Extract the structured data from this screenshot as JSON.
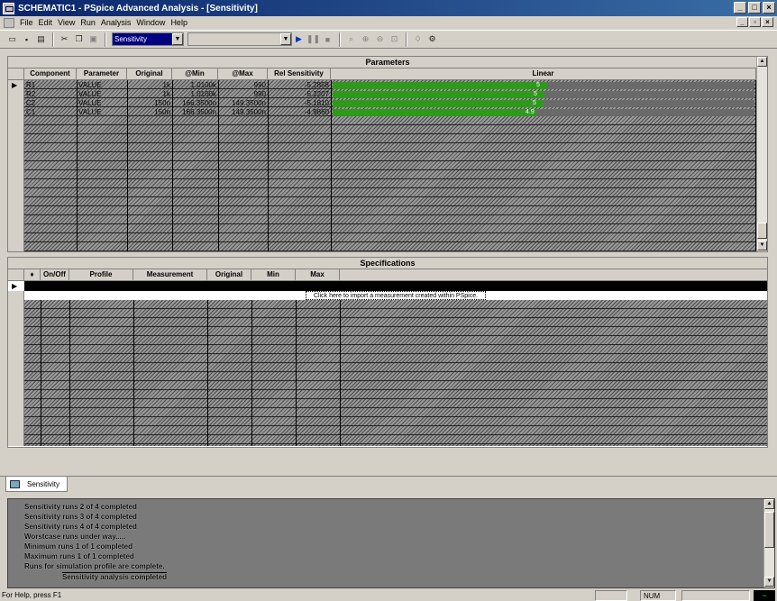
{
  "window": {
    "title": "SCHEMATIC1 - PSpice Advanced Analysis - [Sensitivity]",
    "min_label": "_",
    "max_label": "□",
    "close_label": "×",
    "mdi_min_label": "_",
    "mdi_restore_label": "▫",
    "mdi_close_label": "×"
  },
  "menu": [
    "File",
    "Edit",
    "View",
    "Run",
    "Analysis",
    "Window",
    "Help"
  ],
  "toolbar": {
    "analysis_combo": "Sensitivity",
    "profile_combo": "",
    "combo_arrow": "▼",
    "icons": [
      "open-icon",
      "save-icon",
      "print-icon",
      "cut-icon",
      "copy-icon",
      "paste-icon",
      "run-icon",
      "pause-icon",
      "stop-icon",
      "zoom-fit-icon",
      "zoom-in-icon",
      "zoom-out-icon",
      "zoom-area-icon",
      "find-icon",
      "settings-icon"
    ]
  },
  "parameters": {
    "section_title": "Parameters",
    "columns": [
      "Component",
      "Parameter",
      "Original",
      "@Min",
      "@Max",
      "Rel Sensitivity",
      "Linear"
    ],
    "rows": [
      {
        "component": "R1",
        "parameter": "VALUE",
        "original": "1k",
        "min": "1.0100k",
        "max": "990",
        "rel": "-5.2858",
        "bar_label": "5",
        "fraction": 0.99
      },
      {
        "component": "R2",
        "parameter": "VALUE",
        "original": "1k",
        "min": "1.0100k",
        "max": "990",
        "rel": "-5.2207",
        "bar_label": "5",
        "fraction": 0.98
      },
      {
        "component": "C2",
        "parameter": "VALUE",
        "original": "150n",
        "min": "166.3500n",
        "max": "149.3500n",
        "rel": "-5.1810",
        "bar_label": "5",
        "fraction": 0.975
      },
      {
        "component": "C1",
        "parameter": "VALUE",
        "original": "150n",
        "min": "166.3500n",
        "max": "149.3500n",
        "rel": "-4.9860",
        "bar_label": "4.9",
        "fraction": 0.94
      }
    ],
    "row_marker": "▶"
  },
  "specifications": {
    "section_title": "Specifications",
    "columns": [
      "♦",
      "On/Off",
      "Profile",
      "Measurement",
      "Original",
      "Min",
      "Max"
    ],
    "link_text": "Click here to import a measurement created within PSpice.",
    "row_marker": "▶"
  },
  "tabs": [
    {
      "label": "Sensitivity"
    }
  ],
  "output": {
    "lines": [
      "Sensitivity runs 2 of 4 completed",
      "Sensitivity runs 3 of 4 completed",
      "Sensitivity runs 4 of 4 completed",
      "Worstcase runs under way.....",
      "Minimum runs 1 of 1 completed",
      "Maximum runs 1 of 1 completed",
      "Runs for simulation profile are complete.",
      "Sensitivity analysis completed"
    ]
  },
  "statusbar": {
    "help_text": "For Help, press F1",
    "num_label": "NUM"
  }
}
